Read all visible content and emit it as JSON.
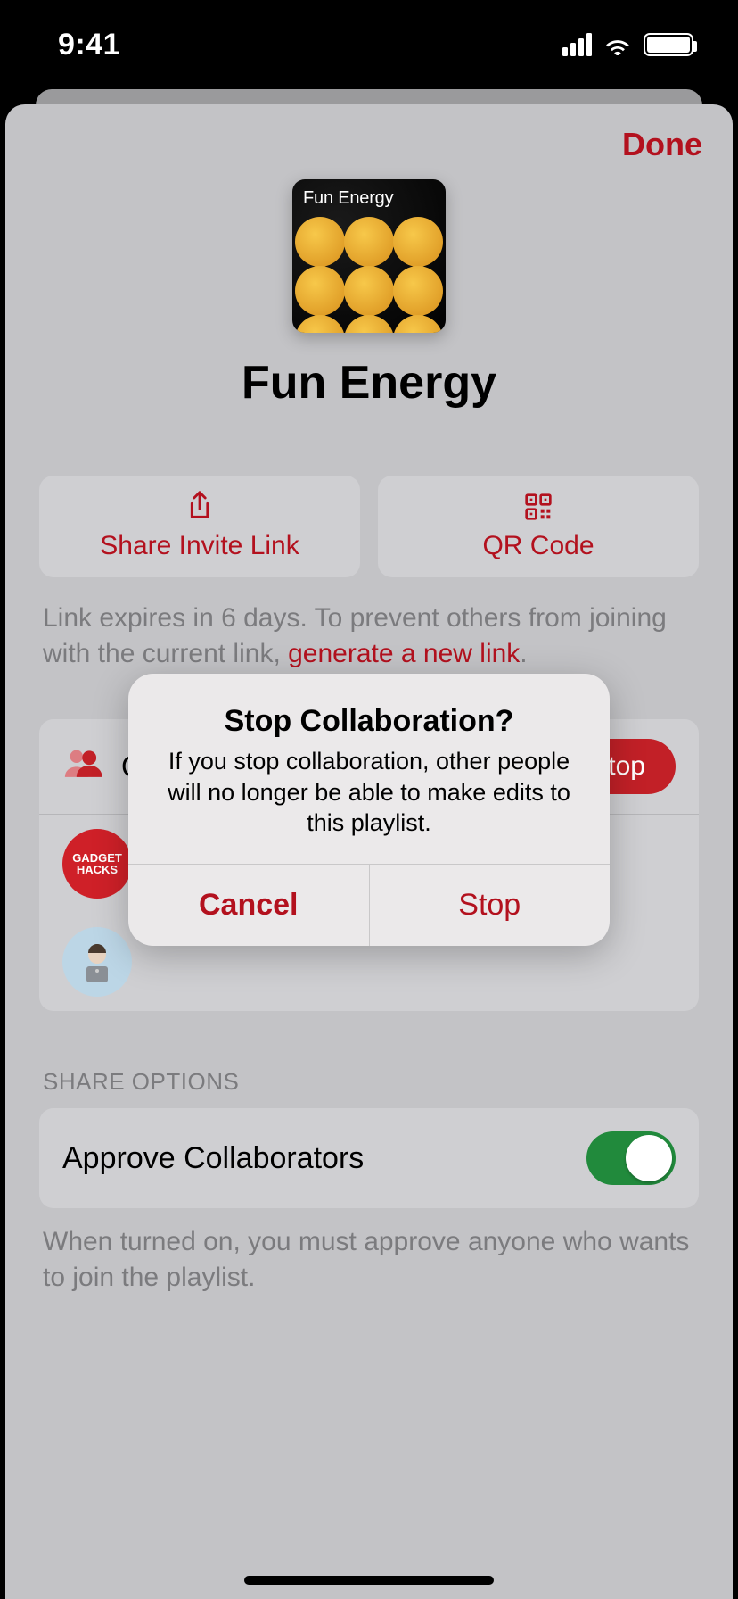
{
  "status": {
    "time": "9:41"
  },
  "header": {
    "done": "Done"
  },
  "playlist": {
    "title": "Fun Energy",
    "artwork_label": "Fun Energy"
  },
  "actions": {
    "share_link": "Share Invite Link",
    "qr_code": "QR Code"
  },
  "expiry": {
    "text_before": "Link expires in 6 days. To prevent others from joining with the current link, ",
    "link": "generate a new link",
    "text_after": "."
  },
  "collaborators": {
    "heading": "Collaborators",
    "stop_label": "Stop",
    "avatar1_text": "GADGET HACKS"
  },
  "share_options": {
    "section": "SHARE OPTIONS",
    "approve_label": "Approve Collaborators",
    "approve_on": true,
    "note": "When turned on, you must approve anyone who wants to join the playlist."
  },
  "alert": {
    "title": "Stop Collaboration?",
    "message": "If you stop collaboration, other people will no longer be able to make edits to this playlist.",
    "cancel": "Cancel",
    "confirm": "Stop"
  }
}
